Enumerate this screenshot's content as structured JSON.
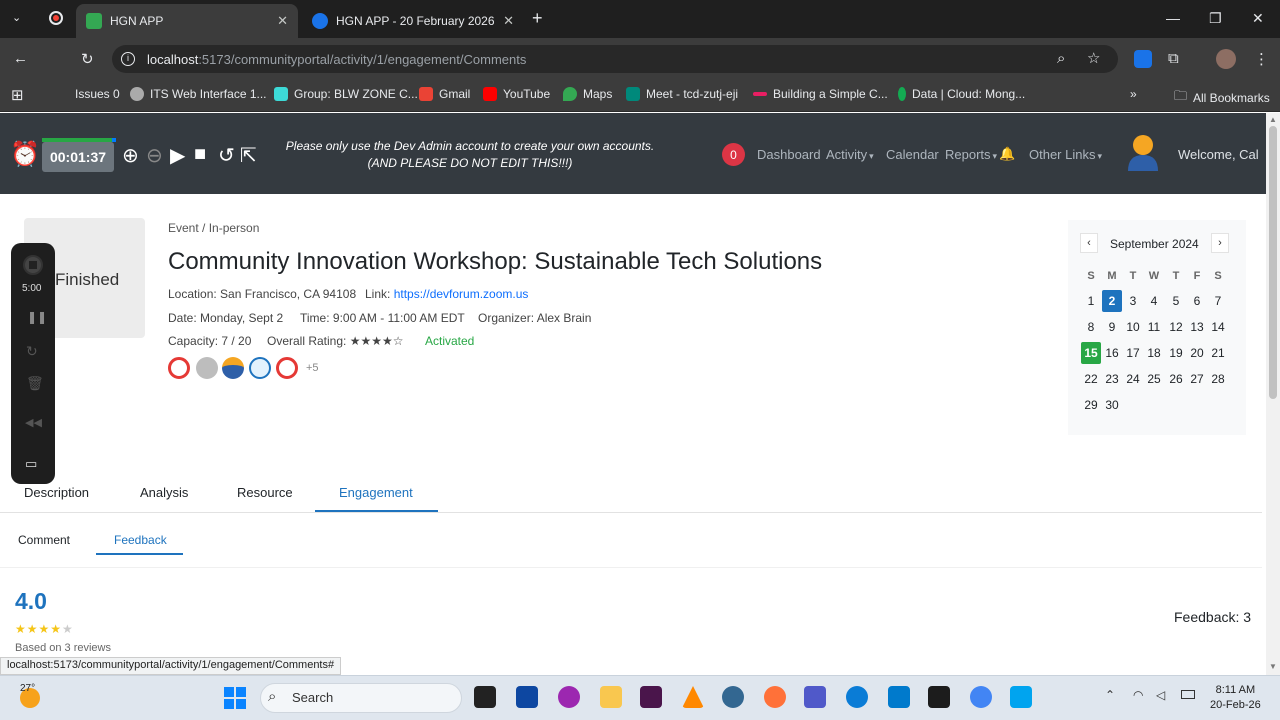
{
  "browser": {
    "tabs": [
      {
        "title": "HGN APP",
        "active": true
      },
      {
        "title": "HGN APP - 20 February 2026",
        "active": false
      }
    ],
    "url_host": "localhost",
    "url_path": ":5173/communityportal/activity/1/engagement/Comments",
    "bookmarks": [
      "Issues 0",
      "ITS Web Interface 1...",
      "Group: BLW ZONE C...",
      "Gmail",
      "YouTube",
      "Maps",
      "Meet - tcd-zutj-eji",
      "Building a Simple C...",
      "Data | Cloud: Mong..."
    ],
    "all_bookmarks": "All Bookmarks",
    "status_url": "localhost:5173/communityportal/activity/1/engagement/Comments#"
  },
  "navbar": {
    "timer": "00:01:37",
    "notice": "Please only use the Dev Admin account to create your own accounts. (AND PLEASE DO NOT EDIT THIS!!!)",
    "badge": "0",
    "links": [
      "Dashboard",
      "Activity",
      "Calendar",
      "Reports",
      "Other Links"
    ],
    "welcome": "Welcome, Cal"
  },
  "recorder": {
    "time": "5:00"
  },
  "event": {
    "status": "Finished",
    "breadcrumb": "Event   / In-person",
    "title": "Community Innovation Workshop: Sustainable Tech Solutions",
    "location": "Location: San Francisco, CA 94108",
    "link_label": "Link: ",
    "link": "https://devforum.zoom.us",
    "date": "Date: Monday, Sept 2",
    "time": "Time: 9:00 AM - 11:00 AM EDT",
    "organizer": "Organizer: Alex Brain",
    "capacity": "Capacity: 7 / 20",
    "overall_rating": "Overall Rating: ★★★★☆",
    "activation": "Activated",
    "more_attendees": "+5"
  },
  "calendar": {
    "month": "September 2024",
    "prev": "‹",
    "next": "›",
    "weekdays": [
      "S",
      "M",
      "T",
      "W",
      "T",
      "F",
      "S"
    ],
    "weeks": [
      [
        "1",
        "2",
        "3",
        "4",
        "5",
        "6",
        "7"
      ],
      [
        "8",
        "9",
        "10",
        "11",
        "12",
        "13",
        "14"
      ],
      [
        "15",
        "16",
        "17",
        "18",
        "19",
        "20",
        "21"
      ],
      [
        "22",
        "23",
        "24",
        "25",
        "26",
        "27",
        "28"
      ],
      [
        "29",
        "30",
        "",
        "",
        "",
        "",
        ""
      ]
    ],
    "selected": "2",
    "today": "15"
  },
  "tabs": [
    "Description",
    "Analysis",
    "Resource",
    "Engagement"
  ],
  "subtabs": [
    "Comment",
    "Feedback"
  ],
  "feedback": {
    "average": "4.0",
    "stars_on": "★★★★",
    "stars_off": "★",
    "based_on": "Based on 3 reviews",
    "count_label": "Feedback: 3"
  },
  "taskbar": {
    "weather": "27°",
    "search": "Search",
    "time": "8:11 AM",
    "date": "20-Feb-26"
  }
}
